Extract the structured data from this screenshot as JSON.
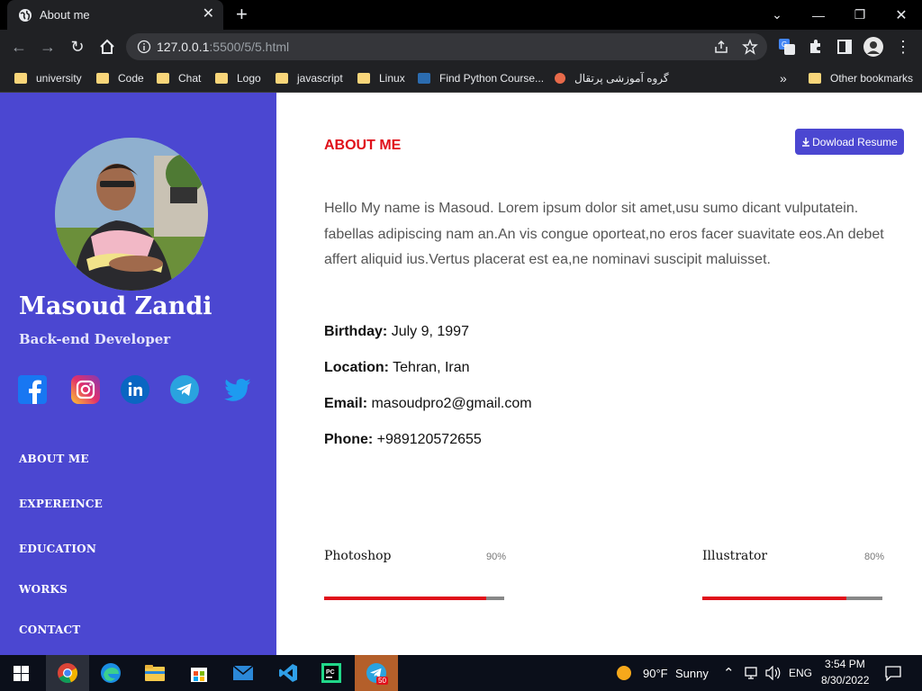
{
  "browser": {
    "tab_title": "About me",
    "url_host": "127.0.0.1",
    "url_path": ":5500/5/5.html",
    "bookmarks": [
      "university",
      "Code",
      "Chat",
      "Logo",
      "javascript",
      "Linux",
      "Find Python Course...",
      "گروه آموزشی پرتقال"
    ],
    "more": "»",
    "other_bookmarks": "Other bookmarks"
  },
  "sidebar": {
    "name": "Masoud Zandi",
    "role": "Back-end Developer",
    "social": [
      "facebook-icon",
      "instagram-icon",
      "linkedin-icon",
      "telegram-icon",
      "twitter-icon"
    ],
    "menu": [
      "ABOUT ME",
      "EXPEREINCE",
      "EDUCATION",
      "WORKS",
      "CONTACT"
    ],
    "accent": "#4b47d1"
  },
  "main": {
    "title": "ABOUT ME",
    "download_label": "Dowload Resume",
    "bio": "Hello My name is Masoud. Lorem ipsum dolor sit amet,usu sumo dicant vulputatein. fabellas adipiscing nam an.An vis congue oporteat,no eros facer suavitate eos.An debet affert aliquid ius.Vertus placerat est ea,ne nominavi suscipit maluisset.",
    "info": [
      {
        "label": "Birthday:",
        "value": "July 9, 1997"
      },
      {
        "label": "Location:",
        "value": "Tehran, Iran"
      },
      {
        "label": "Email:",
        "value": "masoudpro2@gmail.com"
      },
      {
        "label": "Phone:",
        "value": "+989120572655"
      }
    ],
    "skills": [
      {
        "name": "Photoshop",
        "percent_label": "90%",
        "level": 0.9
      },
      {
        "name": "Illustrator",
        "percent_label": "80%",
        "level": 0.8
      }
    ],
    "title_color": "#e0101a"
  },
  "taskbar": {
    "weather_temp": "90°F",
    "weather_desc": "Sunny",
    "lang": "ENG",
    "time": "3:54 PM",
    "date": "8/30/2022",
    "telegram_badge": "50"
  }
}
